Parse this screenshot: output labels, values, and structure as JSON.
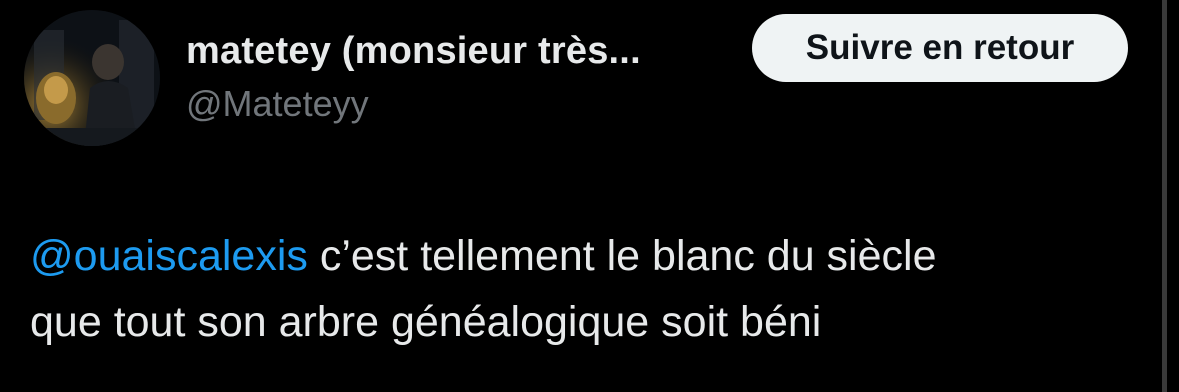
{
  "author": {
    "display_name": "matetey (monsieur très...",
    "handle": "@Mateteyy"
  },
  "follow_button": {
    "label": "Suivre en retour"
  },
  "tweet": {
    "mention": "@ouaiscalexis",
    "text_line1": " c’est tellement le blanc du siècle",
    "text_line2": "que tout son arbre généalogique soit béni"
  },
  "colors": {
    "background": "#000000",
    "text": "#e7e9ea",
    "secondary_text": "#71767b",
    "mention": "#1d9bf0",
    "button_bg": "#eff3f4",
    "button_text": "#0f1419"
  }
}
